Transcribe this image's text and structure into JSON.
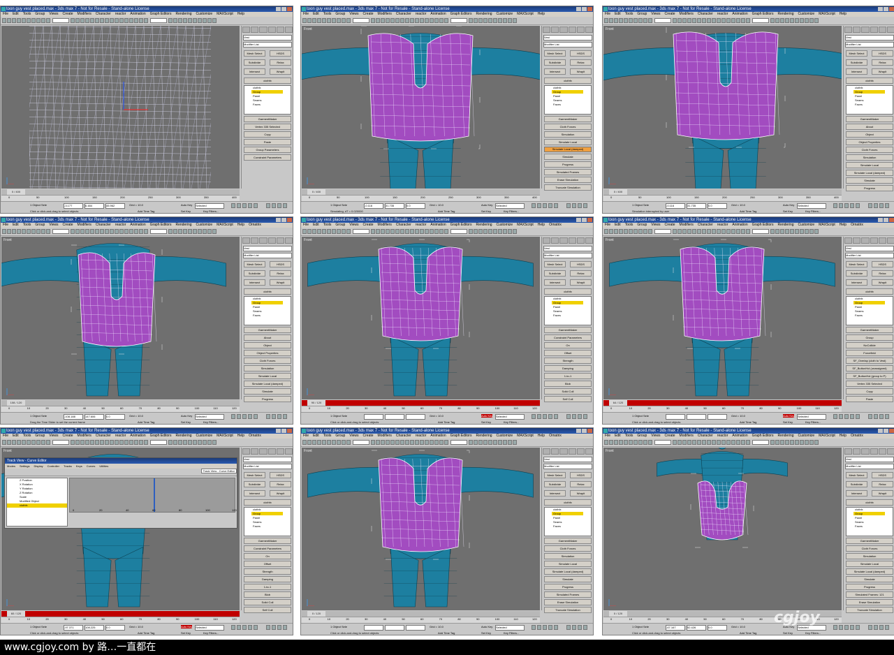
{
  "footer": {
    "credit": "www.cgjoy.com by 路…一直都在"
  },
  "watermark": "cgjoy",
  "app": {
    "window_title": "toon guy vest placed.max - 3ds max 7 - Not for Resale - Stand-alone License",
    "menu": [
      "File",
      "Edit",
      "Tools",
      "Group",
      "Views",
      "Create",
      "Modifiers",
      "Character",
      "reactor",
      "Animation",
      "Graph Editors",
      "Rendering",
      "Customize",
      "MAXScript",
      "Help"
    ],
    "menu_extra": "Ornatrix"
  },
  "panels": [
    {
      "viewport_label": "Front",
      "object_name": "Vest",
      "modifier_list": "Modifier List",
      "buttons": [
        "Mesh Select",
        "HSDS",
        "Subdivide",
        "Relax",
        "Intersect",
        "Wrapit",
        "clothfx",
        "GarmentMaker"
      ],
      "stack": [
        "clothfx",
        "Group",
        "Panel",
        "Seams",
        "Faces"
      ],
      "rollouts": [
        "Vertex 335 Selected",
        "Copy",
        "Paste",
        "Group Parameters",
        "Constraint Parameters"
      ],
      "params": [
        "Offset",
        "Strength",
        "Damping"
      ],
      "time_label": "0 / 400",
      "ruler": [
        "0",
        "50",
        "100",
        "150",
        "200",
        "250",
        "300",
        "350",
        "400"
      ],
      "selection": "1 Object Sele",
      "coords": [
        "-3.177",
        "6.484",
        "45.962"
      ],
      "grid": "Grid = 10.0",
      "prompt": "Click or click-and-drag to select objects",
      "status_right": [
        "Auto Key",
        "Selected",
        "Set Key",
        "Key Filters...",
        "Add Time Tag"
      ]
    },
    {
      "viewport_label": "Front",
      "object_name": "Vest",
      "modifier_list": "Modifier List",
      "buttons": [
        "Mesh Select",
        "HSDS",
        "Subdivide",
        "Relax",
        "Intersect",
        "Wrapit",
        "clothfx",
        "GarmentMaker"
      ],
      "stack": [
        "clothfx",
        "Group",
        "Panel",
        "Seams",
        "Faces"
      ],
      "rollouts": [
        "Cloth Forces",
        "Simulation",
        "Simulate Local",
        "Simulate Local (damped)",
        "Simulate",
        "Progress",
        "Simulated Frames",
        "Erase Simulation",
        "Truncate Simulation",
        "Selected Object Manip",
        "Set Initial State"
      ],
      "params": [],
      "time_label": "0 / 400",
      "ruler": [
        "0",
        "50",
        "100",
        "150",
        "200",
        "250",
        "300",
        "350",
        "400"
      ],
      "selection": "1 Object Sele",
      "coords": [
        "-0.116",
        "31.735",
        "0.0"
      ],
      "grid": "Grid = 10.0",
      "prompt": "Simulating, dT = 0.020000",
      "status_right": [
        "Auto Key",
        "Selected",
        "Set Key",
        "Key Filters...",
        "Add Time Tag"
      ]
    },
    {
      "viewport_label": "Front",
      "object_name": "Vest",
      "modifier_list": "Modifier List",
      "buttons": [
        "Mesh Select",
        "HSDS",
        "Subdivide",
        "Relax",
        "Intersect",
        "Wrapit",
        "clothfx",
        "GarmentMaker"
      ],
      "stack": [
        "clothfx",
        "Group",
        "Panel",
        "Seams",
        "Faces"
      ],
      "rollouts": [
        "About",
        "Object",
        "Object Properties",
        "Cloth Forces",
        "Simulation",
        "Simulate Local",
        "Simulate Local (damped)",
        "Simulate",
        "Progress",
        "Simulated Frames",
        "Erase Simulation"
      ],
      "params": [],
      "time_label": "0 / 400",
      "ruler": [
        "0",
        "50",
        "100",
        "150",
        "200",
        "250",
        "300",
        "350",
        "400"
      ],
      "selection": "1 Object Sele",
      "coords": [
        "-0.116",
        "31.735",
        "0.0"
      ],
      "grid": "Grid = 10.0",
      "prompt": "Simulation interrupted by user",
      "status_right": [
        "Auto Key",
        "Selected",
        "Set Key",
        "Key Filters...",
        "Add Time Tag"
      ]
    },
    {
      "viewport_label": "Front",
      "object_name": "Vest",
      "modifier_list": "Modifier List",
      "buttons": [
        "Mesh Select",
        "HSDS",
        "Subdivide",
        "Relax",
        "Intersect",
        "Wrapit",
        "clothfx",
        "GarmentMaker"
      ],
      "stack": [
        "clothfx",
        "Group",
        "Panel",
        "Seams",
        "Faces"
      ],
      "rollouts": [
        "About",
        "Object",
        "Object Properties",
        "Cloth Forces",
        "Simulation",
        "Simulate Local",
        "Simulate Local (damped)",
        "Simulate",
        "Progress",
        "Simulated Frames: 121",
        "Erase Simulation"
      ],
      "params": [],
      "time_label": "108 / 120",
      "ruler": [
        "0",
        "10",
        "20",
        "30",
        "40",
        "50",
        "60",
        "70",
        "80",
        "90",
        "100",
        "110",
        "120"
      ],
      "selection": "1 Object Sele",
      "coords": [
        "-108.188",
        "147.606",
        "0.0"
      ],
      "grid": "Grid = 10.0",
      "prompt": "Drag the Time Slider to set the current frame",
      "status_right": [
        "Auto Key",
        "Selected",
        "Set Key",
        "Key Filters...",
        "Add Time Tag"
      ]
    },
    {
      "viewport_label": "Front",
      "object_name": "Vest",
      "modifier_list": "Modifier List",
      "buttons": [
        "Mesh Select",
        "HSDS",
        "Subdivide",
        "Relax",
        "Intersect",
        "Wrapit",
        "clothfx",
        "GarmentMaker"
      ],
      "stack": [
        "clothfx",
        "Group",
        "Panel",
        "Seams",
        "Faces"
      ],
      "rollouts": [
        "Constraint Parameters",
        "On",
        "Offset",
        "Strength",
        "Damping",
        "1-to-1",
        "Blob",
        "Solid Coll",
        "Self Coll",
        "Presets",
        "Load...",
        "Save..."
      ],
      "params": [
        "Offset",
        "Strength",
        "Damping"
      ],
      "time_label": "90 / 120",
      "ruler": [
        "0",
        "10",
        "20",
        "30",
        "40",
        "50",
        "60",
        "70",
        "80",
        "90",
        "100",
        "110",
        "120"
      ],
      "selection": "1 Object Sele",
      "coords": [
        "",
        "",
        ""
      ],
      "grid": "Grid = 10.0",
      "prompt": "Click or click-and-drag to select objects",
      "status_right": [
        "Auto Key",
        "Selected",
        "Set Key",
        "Key Filters...",
        "Add Time Tag"
      ]
    },
    {
      "viewport_label": "Front",
      "object_name": "Vest",
      "modifier_list": "Modifier List",
      "buttons": [
        "Mesh Select",
        "HSDS",
        "Subdivide",
        "Relax",
        "Intersect",
        "Wrapit",
        "clothfx",
        "GarmentMaker"
      ],
      "stack": [
        "clothfx",
        "Group",
        "Panel",
        "Seams",
        "Faces"
      ],
      "rollouts": [
        "Group",
        "NoCollide",
        "Forcefield",
        "SF_Overlap (cloth to Vest)",
        "SF_ButtonHol (unassigned)",
        "SF_ButtonHol (group to P)",
        "Vertex 335 Selected",
        "Copy",
        "Paste",
        "Group Parameters"
      ],
      "params": [],
      "time_label": "64 / 120",
      "ruler": [
        "0",
        "10",
        "20",
        "30",
        "40",
        "50",
        "60",
        "70",
        "80",
        "90",
        "100",
        "110",
        "120"
      ],
      "selection": "1 Object Sele",
      "coords": [
        "",
        "",
        ""
      ],
      "grid": "Grid = 10.0",
      "prompt": "Click or click-and-drag to select objects",
      "status_right": [
        "Auto Key",
        "Selected",
        "Set Key",
        "Key Filters...",
        "Add Time Tag"
      ]
    },
    {
      "viewport_label": "Front",
      "object_name": "Vest",
      "modifier_list": "Modifier List",
      "buttons": [
        "Mesh Select",
        "HSDS",
        "Subdivide",
        "Relax",
        "Intersect",
        "Wrapit",
        "clothfx",
        "GarmentMaker"
      ],
      "stack": [
        "clothfx",
        "Group",
        "Panel",
        "Seams",
        "Faces"
      ],
      "rollouts": [
        "Constraint Parameters",
        "On",
        "Offset",
        "Strength",
        "Damping",
        "1-to-1",
        "Blob",
        "Solid Coll",
        "Self Coll",
        "Presets",
        "Load...",
        "Save..."
      ],
      "params": [
        "Offset",
        "Strength",
        "Damping"
      ],
      "time_label": "60 / 120",
      "ruler": [
        "0",
        "10",
        "20",
        "30",
        "40",
        "50",
        "60",
        "70",
        "80",
        "90",
        "100",
        "110",
        "120"
      ],
      "selection": "1 Object Sele",
      "coords": [
        "-97.371",
        "108.225",
        "0.0"
      ],
      "grid": "Grid = 10.0",
      "prompt": "Click or click-and-drag to select objects",
      "status_right": [
        "Auto Key",
        "Selected",
        "Set Key",
        "Key Filters...",
        "Add Time Tag"
      ],
      "trackview": {
        "title": "Track View - Curve Editor",
        "menu": [
          "Modes",
          "Settings",
          "Display",
          "Controller",
          "Tracks",
          "Keys",
          "Curves",
          "Utilities"
        ],
        "dropdown": "Track View - Curve Editor",
        "tree": [
          "Z Position",
          "X Rotation",
          "Y Rotation",
          "Z Rotation",
          "Scale",
          "Modified Object",
          "clothfx"
        ],
        "ruler": [
          "0",
          "20",
          "40",
          "60",
          "80",
          "100",
          "120"
        ]
      }
    },
    {
      "viewport_label": "Front",
      "object_name": "Vest",
      "modifier_list": "Modifier List",
      "buttons": [
        "Mesh Select",
        "HSDS",
        "Subdivide",
        "Relax",
        "Intersect",
        "Wrapit",
        "clothfx",
        "GarmentMaker"
      ],
      "stack": [
        "clothfx",
        "Group",
        "Panel",
        "Seams",
        "Faces"
      ],
      "rollouts": [
        "Cloth Forces",
        "Simulation",
        "Simulate Local",
        "Simulate Local (damped)",
        "Simulate",
        "Progress",
        "Simulated Frames",
        "Erase Simulation",
        "Truncate Simulation",
        "Selected Object Manip",
        "Set Initial State",
        "Reset State"
      ],
      "params": [],
      "time_label": "0 / 120",
      "ruler": [
        "0",
        "10",
        "20",
        "30",
        "40",
        "50",
        "60",
        "70",
        "80",
        "90",
        "100",
        "110",
        "120"
      ],
      "selection": "1 Object Sele",
      "coords": [
        "",
        "",
        ""
      ],
      "grid": "Grid = 10.0",
      "prompt": "Click or click-and-drag to select objects",
      "status_right": [
        "Auto Key",
        "Selected",
        "Set Key",
        "Key Filters...",
        "Add Time Tag"
      ]
    },
    {
      "viewport_label": "Front",
      "object_name": "Vest",
      "modifier_list": "Modifier List",
      "buttons": [
        "Mesh Select",
        "HSDS",
        "Subdivide",
        "Relax",
        "Intersect",
        "Wrapit",
        "clothfx",
        "GarmentMaker"
      ],
      "stack": [
        "clothfx",
        "Group",
        "Panel",
        "Seams",
        "Faces"
      ],
      "rollouts": [
        "Cloth Forces",
        "Simulation",
        "Simulate Local",
        "Simulate Local (damped)",
        "Simulate",
        "Progress",
        "Simulated Frames: 121",
        "Erase Simulation",
        "Truncate Simulation",
        "Selected Object Manip",
        "Set Initial State",
        "Reset State"
      ],
      "params": [],
      "time_label": "0 / 120",
      "ruler": [
        "0",
        "10",
        "20",
        "30",
        "40",
        "50",
        "60",
        "70",
        "80",
        "90",
        "100",
        "110",
        "120"
      ],
      "selection": "1 Object Sele",
      "coords": [
        "-67.167",
        "52.426",
        "0.0"
      ],
      "grid": "Grid = 10.0",
      "prompt": "Click or click-and-drag to select objects",
      "status_right": [
        "Auto Key",
        "Selected",
        "Set Key",
        "Key Filters...",
        "Add Time Tag"
      ]
    }
  ]
}
